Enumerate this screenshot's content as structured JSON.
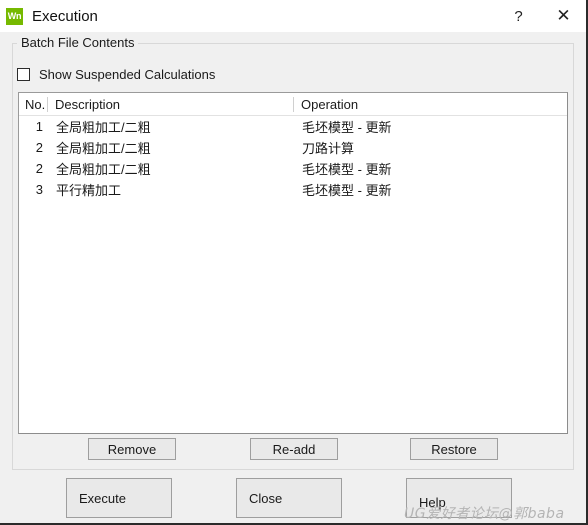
{
  "titlebar": {
    "icon_text": "Wn",
    "icon_name": "app-icon",
    "icon_color": "#76b900",
    "title": "Execution",
    "help_label": "?",
    "close_label": "✕"
  },
  "groupbox": {
    "title": "Batch File Contents"
  },
  "checkbox": {
    "label": "Show Suspended Calculations",
    "checked": false
  },
  "list": {
    "columns": [
      "No.",
      "Description",
      "Operation"
    ],
    "rows": [
      {
        "no": "1",
        "description": "全局粗加工/二粗",
        "operation": "毛坯模型 - 更新"
      },
      {
        "no": "2",
        "description": "全局粗加工/二粗",
        "operation": "刀路计算"
      },
      {
        "no": "2",
        "description": "全局粗加工/二粗",
        "operation": "毛坯模型 - 更新"
      },
      {
        "no": "3",
        "description": "平行精加工",
        "operation": "毛坯模型 - 更新"
      }
    ]
  },
  "mid_buttons": {
    "remove": "Remove",
    "readd": "Re-add",
    "restore": "Restore"
  },
  "bottom_buttons": {
    "execute": "Execute",
    "close": "Close",
    "help": "Help"
  },
  "watermark": {
    "text": "UG爱好者论坛@郭baba"
  }
}
